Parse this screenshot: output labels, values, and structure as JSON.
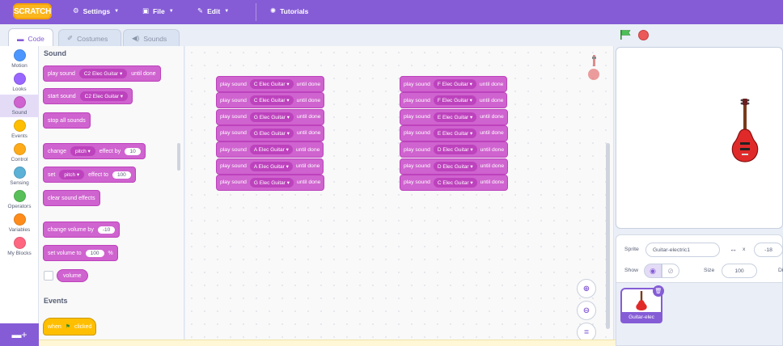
{
  "menubar": {
    "logo": "SCRATCH",
    "settings": "Settings",
    "file": "File",
    "edit": "Edit",
    "tutorials": "Tutorials"
  },
  "tabs": {
    "code": "Code",
    "costumes": "Costumes",
    "sounds": "Sounds"
  },
  "categories": [
    {
      "label": "Motion",
      "color": "#4c97ff"
    },
    {
      "label": "Looks",
      "color": "#9966ff"
    },
    {
      "label": "Sound",
      "color": "#cf63cf"
    },
    {
      "label": "Events",
      "color": "#ffbf00"
    },
    {
      "label": "Control",
      "color": "#ffab19"
    },
    {
      "label": "Sensing",
      "color": "#5cb1d6"
    },
    {
      "label": "Operators",
      "color": "#59c059"
    },
    {
      "label": "Variables",
      "color": "#ff8c1a"
    },
    {
      "label": "My Blocks",
      "color": "#ff6680"
    }
  ],
  "palette": {
    "sound_heading": "Sound",
    "play_sound_until_done": {
      "pre": "play sound",
      "sound": "C2 Elec Guitar",
      "post": "until done"
    },
    "start_sound": {
      "pre": "start sound",
      "sound": "C2 Elec Guitar"
    },
    "stop_all_sounds": "stop all sounds",
    "change_effect": {
      "pre": "change",
      "effect": "pitch",
      "mid": "effect by",
      "value": "10"
    },
    "set_effect": {
      "pre": "set",
      "effect": "pitch",
      "mid": "effect to",
      "value": "100"
    },
    "clear_effects": "clear sound effects",
    "change_volume": {
      "pre": "change volume by",
      "value": "-10"
    },
    "set_volume": {
      "pre": "set volume to",
      "value": "100",
      "unit": "%"
    },
    "volume_reporter": "volume",
    "events_heading": "Events",
    "when_flag": {
      "pre": "when",
      "post": "clicked"
    }
  },
  "script": {
    "play": "play sound",
    "until": "until done",
    "left_stack": [
      "C Elec Guitar",
      "C Elec Guitar",
      "G Elec Guitar",
      "G Elec Guitar",
      "A Elec Guitar",
      "A Elec Guitar",
      "G Elec Guitar"
    ],
    "right_stack": [
      "F Elec Guitar",
      "F Elec Guitar",
      "E Elec Guitar",
      "E Elec Guitar",
      "D Elec Guitar",
      "D Elec Guitar",
      "C Elec Guitar"
    ]
  },
  "sprite_info": {
    "sprite_label": "Sprite",
    "sprite_name": "Guitar-electric1",
    "x_label": "x",
    "x_value": "-18",
    "show_label": "Show",
    "size_label": "Size",
    "size_value": "100",
    "direction_label": "Di"
  },
  "sprite_list": {
    "thumb_label": "Guitar-elec"
  },
  "colors": {
    "accent": "#855cd6",
    "sound": "#cf63cf",
    "events": "#ffbf00"
  }
}
